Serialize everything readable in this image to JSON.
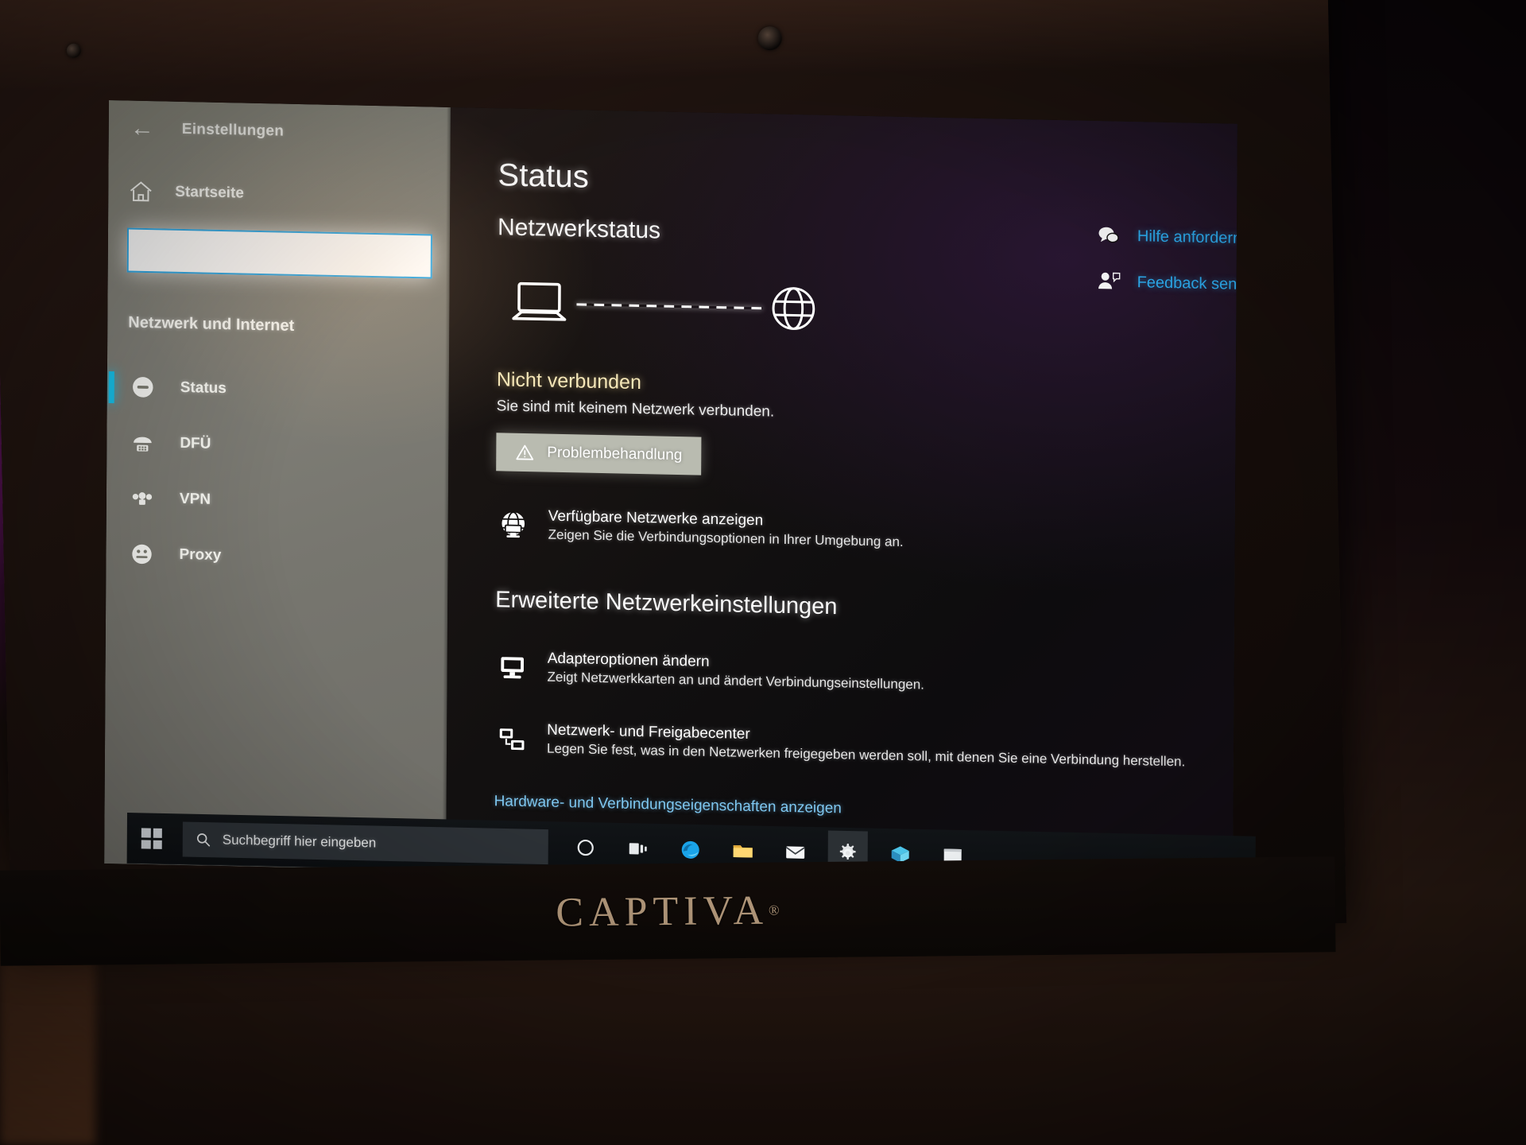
{
  "window": {
    "app_title": "Einstellungen",
    "back_icon": "back-arrow-icon"
  },
  "sidebar": {
    "home_label": "Startseite",
    "home_icon": "home-icon",
    "search": {
      "value": "",
      "placeholder": ""
    },
    "section_title": "Netzwerk und Internet",
    "items": [
      {
        "label": "Status",
        "icon": "status-icon",
        "selected": true
      },
      {
        "label": "DFÜ",
        "icon": "dialup-icon",
        "selected": false
      },
      {
        "label": "VPN",
        "icon": "vpn-icon",
        "selected": false
      },
      {
        "label": "Proxy",
        "icon": "proxy-icon",
        "selected": false
      }
    ]
  },
  "main": {
    "page_title": "Status",
    "section_title": "Netzwerkstatus",
    "diagram": {
      "device_icon": "laptop-icon",
      "link_icon": "dashed-line",
      "internet_icon": "globe-icon"
    },
    "status": {
      "headline": "Nicht verbunden",
      "description": "Sie sind mit keinem Netzwerk verbunden.",
      "button_label": "Problembehandlung",
      "button_icon": "warning-triangle-icon"
    },
    "links": [
      {
        "title": "Verfügbare Netzwerke anzeigen",
        "desc": "Zeigen Sie die Verbindungsoptionen in Ihrer Umgebung an.",
        "icon": "network-globe-icon"
      }
    ],
    "advanced_title": "Erweiterte Netzwerkeinstellungen",
    "advanced_links": [
      {
        "title": "Adapteroptionen ändern",
        "desc": "Zeigt Netzwerkkarten an und ändert Verbindungseinstellungen.",
        "icon": "monitor-icon"
      },
      {
        "title": "Netzwerk- und Freigabecenter",
        "desc": "Legen Sie fest, was in den Netzwerken freigegeben werden soll, mit denen Sie eine Verbindung herstellen.",
        "icon": "sharing-icon"
      }
    ],
    "tail_link": "Hardware- und Verbindungseigenschaften anzeigen"
  },
  "help": {
    "items": [
      {
        "label": "Hilfe anfordern",
        "icon": "chat-help-icon"
      },
      {
        "label": "Feedback senden",
        "icon": "feedback-person-icon"
      }
    ]
  },
  "taskbar": {
    "start_icon": "windows-logo-icon",
    "search_placeholder": "Suchbegriff hier eingeben",
    "search_icon": "search-icon",
    "icons": [
      {
        "name": "cortana-icon"
      },
      {
        "name": "task-view-icon"
      },
      {
        "name": "edge-browser-icon"
      },
      {
        "name": "file-explorer-icon"
      },
      {
        "name": "mail-icon"
      },
      {
        "name": "settings-gear-icon"
      },
      {
        "name": "store-icon"
      },
      {
        "name": "window-icon"
      }
    ]
  },
  "device": {
    "brand": "CAPTIVA",
    "brand_mark": "®"
  },
  "colors": {
    "accent_blue": "#17c6f0",
    "link_blue": "#2ba7e8",
    "status_warning": "#f5e7b8",
    "sidebar_bg": "#7d7d72",
    "content_bg": "#121010"
  }
}
